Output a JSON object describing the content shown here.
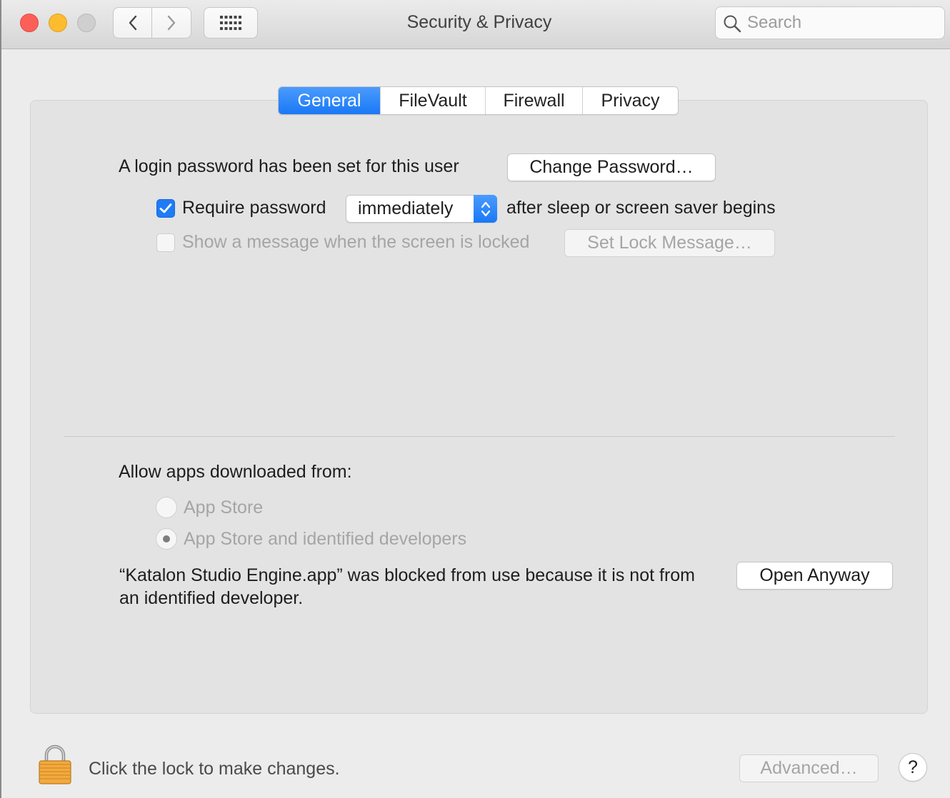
{
  "window": {
    "title": "Security & Privacy",
    "search_placeholder": "Search"
  },
  "toolbar": {
    "back_icon": "chevron-left-icon",
    "forward_icon": "chevron-right-icon",
    "show_all_icon": "grid-icon"
  },
  "tabs": [
    {
      "label": "General",
      "active": true
    },
    {
      "label": "FileVault",
      "active": false
    },
    {
      "label": "Firewall",
      "active": false
    },
    {
      "label": "Privacy",
      "active": false
    }
  ],
  "general": {
    "login_password_text": "A login password has been set for this user",
    "change_password_label": "Change Password…",
    "require_password": {
      "checked": true,
      "label": "Require password",
      "delay_value": "immediately",
      "suffix": "after sleep or screen saver begins"
    },
    "lock_message": {
      "checked": false,
      "enabled": false,
      "label": "Show a message when the screen is locked",
      "button_label": "Set Lock Message…"
    }
  },
  "allow_apps": {
    "heading": "Allow apps downloaded from:",
    "options": [
      {
        "label": "App Store",
        "selected": false,
        "enabled": false
      },
      {
        "label": "App Store and identified developers",
        "selected": true,
        "enabled": false
      }
    ],
    "blocked_message": "“Katalon Studio Engine.app” was blocked from use because it is not from an identified developer.",
    "open_anyway_label": "Open Anyway"
  },
  "footer": {
    "lock_text": "Click the lock to make changes.",
    "advanced_label": "Advanced…",
    "help_label": "?"
  },
  "colors": {
    "accent": "#1f7cf6",
    "close": "#fc5f57",
    "minimize": "#fdbc2e",
    "zoom_disabled": "#cfcfcf",
    "lock_gold": "#f3a93d"
  }
}
